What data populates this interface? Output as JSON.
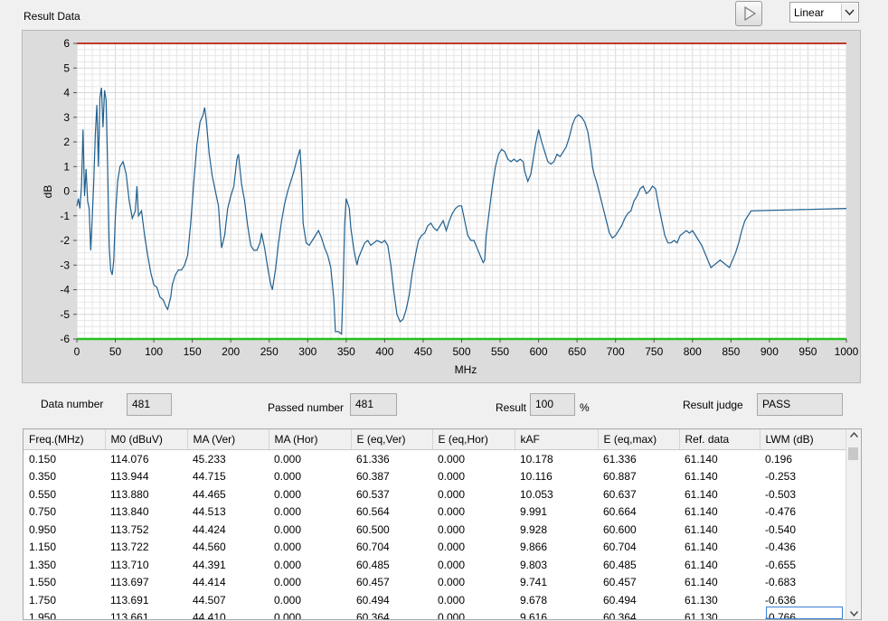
{
  "section_title": "Result Data",
  "scale_select": {
    "value": "Linear"
  },
  "icons": {
    "play": "play-icon",
    "dropdown": "chevron-down-icon",
    "scroll_up": "scroll-up-icon",
    "scroll_down": "scroll-down-icon"
  },
  "colors": {
    "upper_limit": "#c0392b",
    "lower_limit": "#22c11c",
    "trace": "#1f5f8f",
    "grid": "#e6e6e6",
    "plot_bg": "#ffffff"
  },
  "chart_data": {
    "type": "line",
    "xlabel": "MHz",
    "ylabel": "dB",
    "xlim": [
      0,
      1000
    ],
    "ylim": [
      -6,
      6
    ],
    "x_ticks": [
      0,
      50,
      100,
      150,
      200,
      250,
      300,
      350,
      400,
      450,
      500,
      550,
      600,
      650,
      700,
      750,
      800,
      850,
      900,
      950,
      1000
    ],
    "y_ticks": [
      6,
      5,
      4,
      3,
      2,
      1,
      0,
      -1,
      -2,
      -3,
      -4,
      -5,
      -6
    ],
    "grid": true,
    "upper_limit": 6,
    "lower_limit": -6,
    "series": [
      {
        "points": [
          [
            0.15,
            -0.6
          ],
          [
            2,
            -0.3
          ],
          [
            4,
            -0.7
          ],
          [
            6,
            0.2
          ],
          [
            8,
            2.5
          ],
          [
            10,
            -0.2
          ],
          [
            12,
            0.9
          ],
          [
            14,
            -0.4
          ],
          [
            16,
            -0.7
          ],
          [
            18,
            -2.4
          ],
          [
            20,
            -1.1
          ],
          [
            22,
            0.4
          ],
          [
            24,
            2.3
          ],
          [
            26,
            3.5
          ],
          [
            28,
            1.0
          ],
          [
            30,
            3.8
          ],
          [
            32,
            4.2
          ],
          [
            34,
            2.6
          ],
          [
            36,
            4.1
          ],
          [
            38,
            3.7
          ],
          [
            40,
            1.0
          ],
          [
            42,
            -2.2
          ],
          [
            44,
            -3.2
          ],
          [
            46,
            -3.4
          ],
          [
            48,
            -2.8
          ],
          [
            50,
            -1.0
          ],
          [
            53,
            0.4
          ],
          [
            56,
            1.0
          ],
          [
            60,
            1.2
          ],
          [
            64,
            0.7
          ],
          [
            68,
            -0.4
          ],
          [
            72,
            -1.1
          ],
          [
            76,
            -0.8
          ],
          [
            78,
            0.2
          ],
          [
            80,
            -1.0
          ],
          [
            84,
            -0.8
          ],
          [
            88,
            -1.8
          ],
          [
            92,
            -2.6
          ],
          [
            96,
            -3.3
          ],
          [
            100,
            -3.8
          ],
          [
            104,
            -3.9
          ],
          [
            108,
            -4.3
          ],
          [
            112,
            -4.4
          ],
          [
            116,
            -4.7
          ],
          [
            118,
            -4.8
          ],
          [
            122,
            -4.3
          ],
          [
            124,
            -3.8
          ],
          [
            128,
            -3.4
          ],
          [
            132,
            -3.2
          ],
          [
            136,
            -3.2
          ],
          [
            140,
            -3.0
          ],
          [
            144,
            -2.6
          ],
          [
            148,
            -1.3
          ],
          [
            152,
            0.4
          ],
          [
            156,
            1.9
          ],
          [
            160,
            2.8
          ],
          [
            164,
            3.1
          ],
          [
            166,
            3.4
          ],
          [
            168,
            2.9
          ],
          [
            172,
            1.5
          ],
          [
            176,
            0.6
          ],
          [
            180,
            0.0
          ],
          [
            184,
            -0.6
          ],
          [
            186,
            -1.5
          ],
          [
            188,
            -2.3
          ],
          [
            192,
            -1.8
          ],
          [
            196,
            -0.7
          ],
          [
            200,
            -0.2
          ],
          [
            204,
            0.2
          ],
          [
            208,
            1.3
          ],
          [
            210,
            1.5
          ],
          [
            214,
            0.3
          ],
          [
            218,
            -0.4
          ],
          [
            222,
            -1.4
          ],
          [
            226,
            -2.2
          ],
          [
            230,
            -2.4
          ],
          [
            234,
            -2.4
          ],
          [
            238,
            -2.1
          ],
          [
            240,
            -1.7
          ],
          [
            244,
            -2.3
          ],
          [
            248,
            -3.1
          ],
          [
            252,
            -3.8
          ],
          [
            254,
            -4.0
          ],
          [
            258,
            -3.2
          ],
          [
            262,
            -2.1
          ],
          [
            266,
            -1.2
          ],
          [
            270,
            -0.5
          ],
          [
            274,
            0.0
          ],
          [
            278,
            0.4
          ],
          [
            282,
            0.8
          ],
          [
            286,
            1.3
          ],
          [
            290,
            1.7
          ],
          [
            292,
            0.6
          ],
          [
            294,
            -1.3
          ],
          [
            298,
            -2.1
          ],
          [
            302,
            -2.2
          ],
          [
            306,
            -2.0
          ],
          [
            310,
            -1.8
          ],
          [
            314,
            -1.6
          ],
          [
            318,
            -1.9
          ],
          [
            322,
            -2.3
          ],
          [
            326,
            -2.6
          ],
          [
            330,
            -3.1
          ],
          [
            334,
            -4.4
          ],
          [
            336,
            -5.7
          ],
          [
            340,
            -5.7
          ],
          [
            344,
            -5.8
          ],
          [
            346,
            -3.9
          ],
          [
            348,
            -1.4
          ],
          [
            350,
            -0.3
          ],
          [
            354,
            -0.7
          ],
          [
            356,
            -1.5
          ],
          [
            360,
            -2.4
          ],
          [
            364,
            -3.0
          ],
          [
            366,
            -2.7
          ],
          [
            370,
            -2.4
          ],
          [
            374,
            -2.1
          ],
          [
            378,
            -2.0
          ],
          [
            382,
            -2.2
          ],
          [
            386,
            -2.1
          ],
          [
            390,
            -2.0
          ],
          [
            396,
            -2.1
          ],
          [
            400,
            -2.0
          ],
          [
            404,
            -2.2
          ],
          [
            408,
            -3.0
          ],
          [
            412,
            -4.1
          ],
          [
            416,
            -5.0
          ],
          [
            420,
            -5.3
          ],
          [
            424,
            -5.2
          ],
          [
            428,
            -4.8
          ],
          [
            432,
            -4.2
          ],
          [
            436,
            -3.3
          ],
          [
            440,
            -2.6
          ],
          [
            444,
            -2.0
          ],
          [
            448,
            -1.8
          ],
          [
            452,
            -1.7
          ],
          [
            456,
            -1.4
          ],
          [
            460,
            -1.3
          ],
          [
            464,
            -1.5
          ],
          [
            468,
            -1.6
          ],
          [
            472,
            -1.4
          ],
          [
            476,
            -1.2
          ],
          [
            480,
            -1.6
          ],
          [
            484,
            -1.2
          ],
          [
            488,
            -0.9
          ],
          [
            492,
            -0.7
          ],
          [
            496,
            -0.6
          ],
          [
            500,
            -0.6
          ],
          [
            504,
            -1.2
          ],
          [
            508,
            -1.8
          ],
          [
            512,
            -2.0
          ],
          [
            516,
            -2.0
          ],
          [
            520,
            -2.3
          ],
          [
            524,
            -2.6
          ],
          [
            528,
            -2.9
          ],
          [
            530,
            -2.8
          ],
          [
            532,
            -1.8
          ],
          [
            536,
            -0.8
          ],
          [
            540,
            0.2
          ],
          [
            544,
            1.0
          ],
          [
            548,
            1.5
          ],
          [
            552,
            1.7
          ],
          [
            556,
            1.6
          ],
          [
            560,
            1.3
          ],
          [
            564,
            1.2
          ],
          [
            568,
            1.3
          ],
          [
            572,
            1.2
          ],
          [
            576,
            1.3
          ],
          [
            580,
            1.2
          ],
          [
            582,
            0.8
          ],
          [
            586,
            0.4
          ],
          [
            590,
            0.7
          ],
          [
            594,
            1.5
          ],
          [
            596,
            1.9
          ],
          [
            600,
            2.5
          ],
          [
            604,
            2.0
          ],
          [
            608,
            1.6
          ],
          [
            612,
            1.2
          ],
          [
            616,
            1.1
          ],
          [
            620,
            1.2
          ],
          [
            624,
            1.5
          ],
          [
            628,
            1.4
          ],
          [
            632,
            1.6
          ],
          [
            636,
            1.8
          ],
          [
            640,
            2.2
          ],
          [
            644,
            2.7
          ],
          [
            648,
            3.0
          ],
          [
            652,
            3.1
          ],
          [
            656,
            3.0
          ],
          [
            660,
            2.8
          ],
          [
            664,
            2.4
          ],
          [
            668,
            1.6
          ],
          [
            670,
            1.0
          ],
          [
            672,
            0.7
          ],
          [
            676,
            0.3
          ],
          [
            680,
            -0.2
          ],
          [
            684,
            -0.7
          ],
          [
            688,
            -1.2
          ],
          [
            692,
            -1.7
          ],
          [
            696,
            -1.9
          ],
          [
            700,
            -1.8
          ],
          [
            704,
            -1.6
          ],
          [
            708,
            -1.4
          ],
          [
            712,
            -1.1
          ],
          [
            716,
            -0.9
          ],
          [
            720,
            -0.8
          ],
          [
            724,
            -0.4
          ],
          [
            728,
            -0.2
          ],
          [
            732,
            0.1
          ],
          [
            736,
            0.2
          ],
          [
            740,
            -0.1
          ],
          [
            744,
            0.0
          ],
          [
            748,
            0.2
          ],
          [
            752,
            0.1
          ],
          [
            756,
            -0.6
          ],
          [
            760,
            -1.2
          ],
          [
            764,
            -1.8
          ],
          [
            768,
            -2.1
          ],
          [
            772,
            -2.1
          ],
          [
            776,
            -2.0
          ],
          [
            780,
            -2.1
          ],
          [
            784,
            -1.8
          ],
          [
            788,
            -1.7
          ],
          [
            792,
            -1.6
          ],
          [
            796,
            -1.7
          ],
          [
            800,
            -1.6
          ],
          [
            804,
            -1.8
          ],
          [
            808,
            -2.0
          ],
          [
            812,
            -2.2
          ],
          [
            816,
            -2.5
          ],
          [
            820,
            -2.8
          ],
          [
            824,
            -3.1
          ],
          [
            828,
            -3.0
          ],
          [
            832,
            -2.9
          ],
          [
            836,
            -2.8
          ],
          [
            840,
            -2.9
          ],
          [
            844,
            -3.0
          ],
          [
            848,
            -3.1
          ],
          [
            852,
            -2.8
          ],
          [
            856,
            -2.5
          ],
          [
            860,
            -2.1
          ],
          [
            864,
            -1.6
          ],
          [
            868,
            -1.2
          ],
          [
            872,
            -1.0
          ],
          [
            876,
            -0.8
          ],
          [
            1000,
            -0.7
          ]
        ]
      }
    ]
  },
  "summary": {
    "data_number_label": "Data number",
    "data_number": "481",
    "passed_number_label": "Passed number",
    "passed_number": "481",
    "result_label": "Result",
    "result_value": "100",
    "result_unit": "%",
    "result_judge_label": "Result judge",
    "result_judge": "PASS"
  },
  "table": {
    "columns": [
      "Freq.(MHz)",
      "M0 (dBuV)",
      "MA (Ver)",
      "MA (Hor)",
      "E (eq,Ver)",
      "E (eq,Hor)",
      "kAF",
      "E (eq,max)",
      "Ref. data",
      "LWM (dB)"
    ],
    "rows": [
      [
        "0.150",
        "114.076",
        "45.233",
        "0.000",
        "61.336",
        "0.000",
        "10.178",
        "61.336",
        "61.140",
        "0.196"
      ],
      [
        "0.350",
        "113.944",
        "44.715",
        "0.000",
        "60.387",
        "0.000",
        "10.116",
        "60.887",
        "61.140",
        "-0.253"
      ],
      [
        "0.550",
        "113.880",
        "44.465",
        "0.000",
        "60.537",
        "0.000",
        "10.053",
        "60.637",
        "61.140",
        "-0.503"
      ],
      [
        "0.750",
        "113.840",
        "44.513",
        "0.000",
        "60.564",
        "0.000",
        "9.991",
        "60.664",
        "61.140",
        "-0.476"
      ],
      [
        "0.950",
        "113.752",
        "44.424",
        "0.000",
        "60.500",
        "0.000",
        "9.928",
        "60.600",
        "61.140",
        "-0.540"
      ],
      [
        "1.150",
        "113.722",
        "44.560",
        "0.000",
        "60.704",
        "0.000",
        "9.866",
        "60.704",
        "61.140",
        "-0.436"
      ],
      [
        "1.350",
        "113.710",
        "44.391",
        "0.000",
        "60.485",
        "0.000",
        "9.803",
        "60.485",
        "61.140",
        "-0.655"
      ],
      [
        "1.550",
        "113.697",
        "44.414",
        "0.000",
        "60.457",
        "0.000",
        "9.741",
        "60.457",
        "61.140",
        "-0.683"
      ],
      [
        "1.750",
        "113.691",
        "44.507",
        "0.000",
        "60.494",
        "0.000",
        "9.678",
        "60.494",
        "61.130",
        "-0.636"
      ],
      [
        "1.950",
        "113.661",
        "44.410",
        "0.000",
        "60.364",
        "0.000",
        "9.616",
        "60.364",
        "61.130",
        "-0.766"
      ]
    ]
  }
}
